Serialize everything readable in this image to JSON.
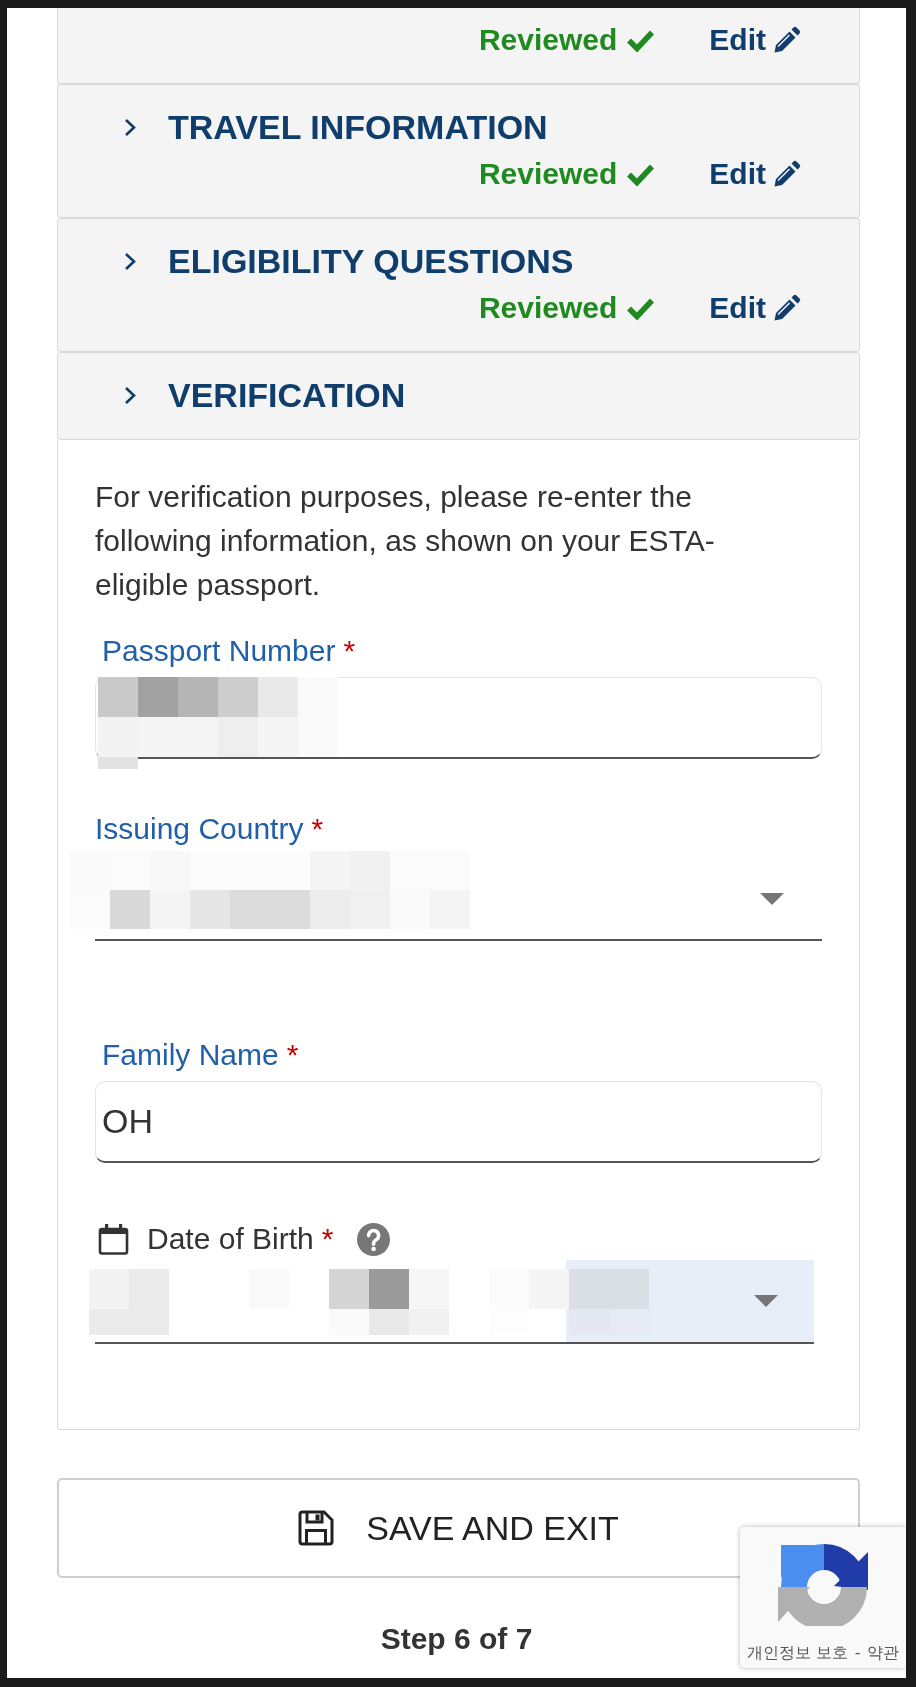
{
  "sections": [
    {
      "status": "Reviewed",
      "edit": "Edit"
    },
    {
      "title": "TRAVEL INFORMATION",
      "status": "Reviewed",
      "edit": "Edit"
    },
    {
      "title": "ELIGIBILITY QUESTIONS",
      "status": "Reviewed",
      "edit": "Edit"
    },
    {
      "title": "VERIFICATION"
    }
  ],
  "verification": {
    "intro": "For verification purposes, please re-enter the following information, as shown on your ESTA-eligible passport.",
    "fields": [
      {
        "kind": "text",
        "label": "Passport Number",
        "required_mark": "*",
        "redacted": true
      },
      {
        "kind": "select",
        "label": "Issuing Country",
        "required_mark": "*",
        "redacted": true
      },
      {
        "kind": "text",
        "label": "Family Name",
        "required_mark": "*",
        "value": "OH",
        "redacted": false
      },
      {
        "kind": "date",
        "label": "Date of Birth",
        "required_mark": "*",
        "redacted": true,
        "focused": true
      }
    ]
  },
  "save_button": {
    "label": "SAVE AND EXIT"
  },
  "step": "Step 6 of 7",
  "badge": {
    "privacy_link": "개인정보 보호",
    "separator": "-",
    "terms_link": "약관"
  }
}
